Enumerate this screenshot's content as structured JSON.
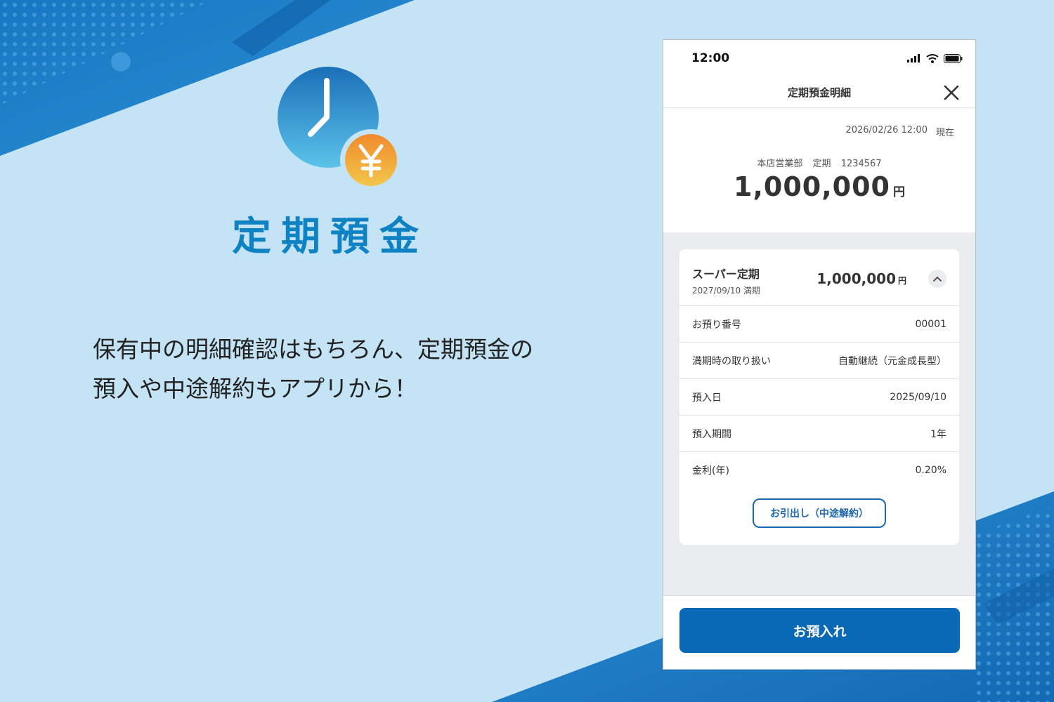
{
  "colors": {
    "accent": "#0a69b6",
    "title_blue": "#0f82c4",
    "background": "#c4e4f6"
  },
  "promo": {
    "title": "定期預金",
    "text_line1": "保有中の明細確認はもちろん、定期預金の",
    "text_line2": "預入や中途解約もアプリから！",
    "icon": "clock-yen-icon"
  },
  "status_bar": {
    "time": "12:00",
    "icons": [
      "signal-icon",
      "wifi-icon",
      "battery-icon"
    ]
  },
  "header": {
    "title": "定期預金明細",
    "close_icon": "close-icon"
  },
  "summary": {
    "timestamp": "2026/02/26 12:00",
    "as_of_label": "現在",
    "branch": "本店営業部",
    "account_type": "定期",
    "account_number": "1234567",
    "total_amount": "1,000,000",
    "currency": "円"
  },
  "product": {
    "name": "スーパー定期",
    "maturity_date": "2027/09/10",
    "maturity_label": "満期",
    "amount": "1,000,000",
    "currency": "円",
    "details": [
      {
        "label": "お預り番号",
        "value": "00001"
      },
      {
        "label": "満期時の取り扱い",
        "value": "自動継続（元金成長型）"
      },
      {
        "label": "預入日",
        "value": "2025/09/10"
      },
      {
        "label": "預入期間",
        "value": "1年"
      },
      {
        "label": "金利(年)",
        "value": "0.20%"
      }
    ],
    "withdraw_label": "お引出し（中途解約）"
  },
  "footer": {
    "deposit_label": "お預入れ"
  }
}
